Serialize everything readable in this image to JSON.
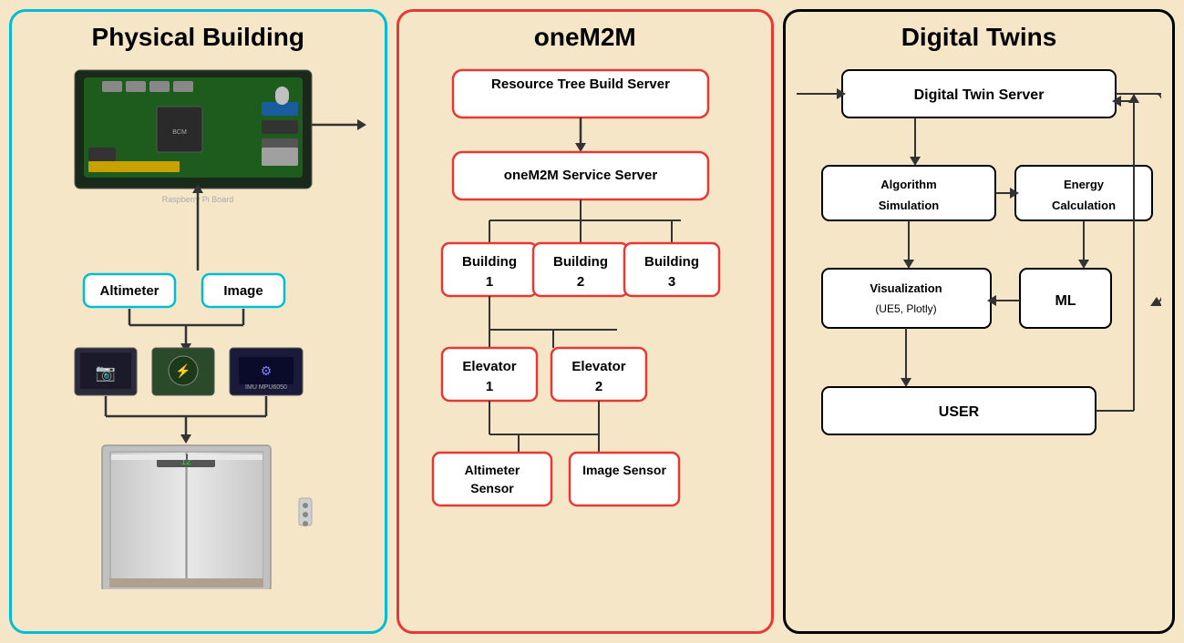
{
  "sections": {
    "physical_building": {
      "title": "Physical Building",
      "border_color": "#00bcd4",
      "sensors": {
        "altimeter_label": "Altimeter",
        "image_label": "Image"
      },
      "raspberry_pi_label": "Raspberry Pi"
    },
    "onem2m": {
      "title": "oneM2M",
      "border_color": "#e53935",
      "resource_tree_server": "Resource Tree Build Server",
      "service_server": "oneM2M Service Server",
      "building1": "Building\n1",
      "building2": "Building\n2",
      "building3": "Building\n3",
      "elevator1": "Elevator\n1",
      "elevator2": "Elevator\n2",
      "altimeter_sensor": "Altimeter\nSensor",
      "image_sensor": "Image Sensor",
      "dots": "..."
    },
    "digital_twins": {
      "title": "Digital Twins",
      "border_color": "#000000",
      "dt_server": "Digital Twin Server",
      "algorithm_simulation": "Algorithm Simulation",
      "energy_calculation": "Energy Calculation",
      "visualization": "Visualization\n(UE5, Plotly)",
      "ml": "ML",
      "user": "USER"
    }
  }
}
